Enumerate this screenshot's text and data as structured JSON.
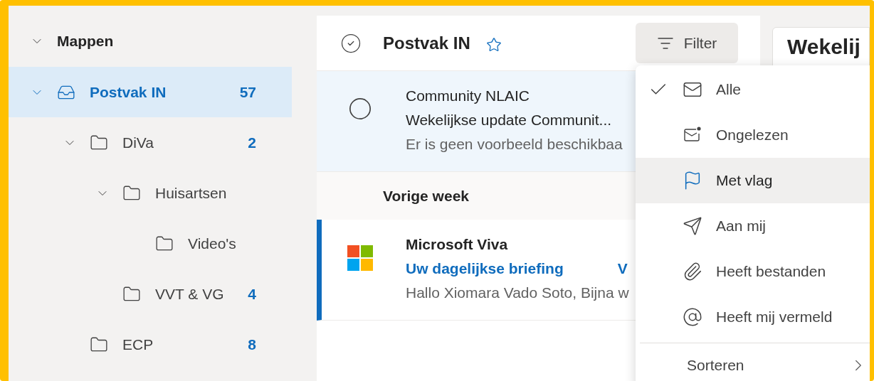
{
  "sidebar": {
    "section": {
      "label": "Mappen",
      "expanded": true
    },
    "folders": [
      {
        "label": "Postvak IN",
        "kind": "inbox",
        "count": "57",
        "selected": true,
        "expanded": true,
        "children": [
          {
            "label": "DiVa",
            "kind": "folder",
            "count": "2",
            "selected": false,
            "expanded": true,
            "children": [
              {
                "label": "Huisartsen",
                "kind": "folder",
                "selected": false,
                "expanded": true,
                "children": [
                  {
                    "label": "Video's",
                    "kind": "folder",
                    "selected": false
                  }
                ]
              },
              {
                "label": "VVT & VG",
                "kind": "folder",
                "count": "4",
                "selected": false
              }
            ]
          },
          {
            "label": "ECP",
            "kind": "folder",
            "count": "8",
            "selected": false
          }
        ]
      }
    ]
  },
  "message_list": {
    "title": "Postvak IN",
    "filter_button": "Filter",
    "items": [
      {
        "kind": "message",
        "sender": "Community NLAIC",
        "subject": "Wekelijkse update Communit...",
        "preview": "Er is geen voorbeeld beschikbaa",
        "selected": true,
        "unread": false
      },
      {
        "kind": "group",
        "label": "Vorige week"
      },
      {
        "kind": "app_message",
        "sender": "Microsoft Viva",
        "subject": "Uw dagelijkse briefing",
        "subject_right": "V",
        "preview": "Hallo Xiomara Vado Soto, Bijna w",
        "selected": false,
        "unread": true
      }
    ]
  },
  "reading_pane": {
    "title": "Wekelij"
  },
  "filter_menu": {
    "items": [
      {
        "label": "Alle",
        "kind": "all",
        "selected": true,
        "hovered": false
      },
      {
        "label": "Ongelezen",
        "kind": "unread",
        "selected": false,
        "hovered": false
      },
      {
        "label": "Met vlag",
        "kind": "flagged",
        "selected": false,
        "hovered": true
      },
      {
        "label": "Aan mij",
        "kind": "to_me",
        "selected": false,
        "hovered": false
      },
      {
        "label": "Heeft bestanden",
        "kind": "attachments",
        "selected": false,
        "hovered": false
      },
      {
        "label": "Heeft mij vermeld",
        "kind": "mentions",
        "selected": false,
        "hovered": false
      }
    ],
    "sort": {
      "label": "Sorteren"
    }
  }
}
